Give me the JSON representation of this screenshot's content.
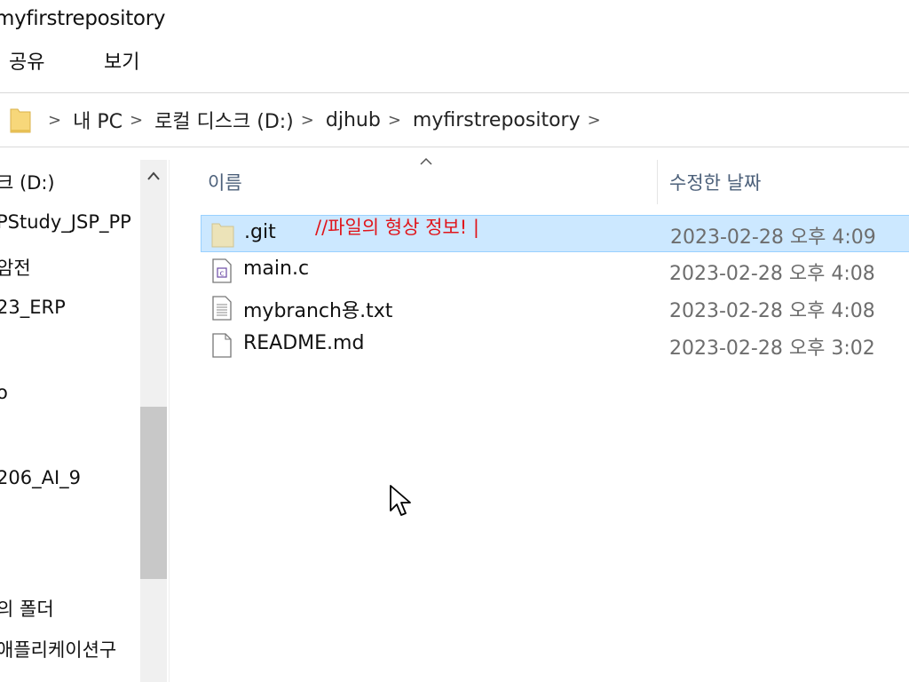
{
  "window": {
    "title": "myfirstrepository"
  },
  "ribbon": {
    "tabs": [
      "공유",
      "보기"
    ]
  },
  "address": {
    "separators": ">",
    "crumbs": [
      "내 PC",
      "로컬 디스크 (D:)",
      "djhub",
      "myfirstrepository"
    ]
  },
  "nav": {
    "items": [
      "크 (D:)",
      "PStudy_JSP_PP",
      "암전",
      "23_ERP",
      "o",
      "206_AI_9",
      "의 폴더",
      "애플리케이션구"
    ]
  },
  "columns": {
    "name": "이름",
    "date": "수정한 날짜"
  },
  "files": [
    {
      "name": ".git",
      "date": "2023-02-28 오후 4:09",
      "icon": "folder-icon",
      "selected": true
    },
    {
      "name": "main.c",
      "date": "2023-02-28 오후 4:08",
      "icon": "c-file-icon",
      "selected": false
    },
    {
      "name": "mybranch용.txt",
      "date": "2023-02-28 오후 4:08",
      "icon": "text-file-icon",
      "selected": false
    },
    {
      "name": "README.md",
      "date": "2023-02-28 오후 3:02",
      "icon": "blank-file-icon",
      "selected": false
    }
  ],
  "annotation": {
    "text": "//파일의 형상 정보! |"
  },
  "colors": {
    "selection": "#cce8ff",
    "selection_border": "#99d1ff",
    "annotation": "#e0151b",
    "folder": "#f7d77a"
  }
}
